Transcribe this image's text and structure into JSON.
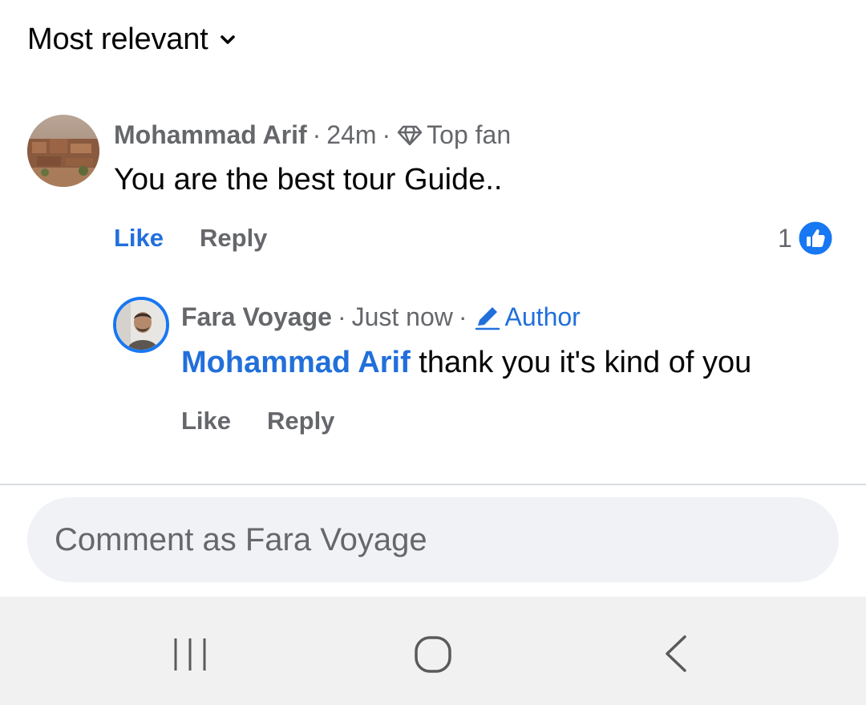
{
  "sort": {
    "label": "Most relevant",
    "icon": "chevron-down-icon"
  },
  "comments": [
    {
      "author": "Mohammad Arif",
      "time": "24m",
      "badge": "Top fan",
      "badge_icon": "diamond-icon",
      "text": "You are the best tour Guide..",
      "like_label": "Like",
      "reply_label": "Reply",
      "liked": true,
      "reaction_count": "1",
      "reaction_icon": "thumbs-up-icon"
    }
  ],
  "reply": {
    "author": "Fara Voyage",
    "time": "Just now",
    "badge": "Author",
    "badge_icon": "pencil-icon",
    "mention": "Mohammad Arif",
    "text": "thank you it's kind of you",
    "like_label": "Like",
    "reply_label": "Reply"
  },
  "composer": {
    "placeholder": "Comment as Fara Voyage"
  },
  "navbar": {
    "recent_icon": "recent-apps-icon",
    "home_icon": "home-icon",
    "back_icon": "back-icon"
  },
  "colors": {
    "accent": "#216fdb",
    "secondary_text": "#65676b",
    "composer_bg": "#f0f2f5",
    "navbar_bg": "#f1f1f1"
  }
}
